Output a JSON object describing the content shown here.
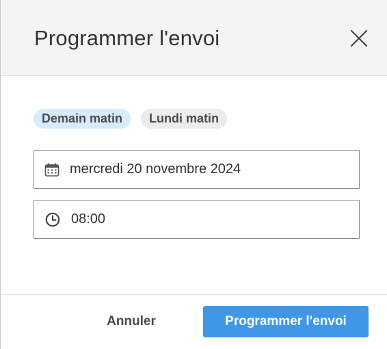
{
  "dialog": {
    "title": "Programmer l'envoi",
    "close_icon": "close-icon"
  },
  "quick_options": [
    {
      "label": "Demain matin",
      "selected": true
    },
    {
      "label": "Lundi matin",
      "selected": false
    }
  ],
  "date_field": {
    "icon": "calendar-icon",
    "value": "mercredi 20 novembre 2024"
  },
  "time_field": {
    "icon": "clock-icon",
    "value": "08:00"
  },
  "footer": {
    "cancel_label": "Annuler",
    "submit_label": "Programmer l'envoi"
  },
  "colors": {
    "accent": "#3f97ea",
    "chip_selected": "#d6ecfb",
    "chip_default": "#ececec",
    "header_bg": "#f4f4f4"
  }
}
